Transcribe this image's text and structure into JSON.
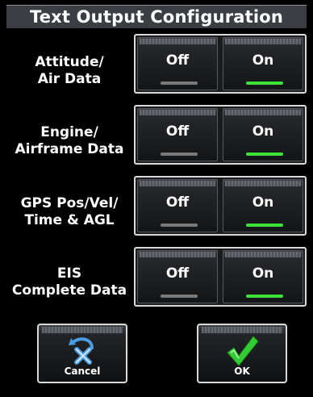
{
  "title": "Text Output Configuration",
  "rows": [
    {
      "label": "Attitude/\nAir Data",
      "off_label": "Off",
      "on_label": "On",
      "selected": "on"
    },
    {
      "label": "Engine/\nAirframe Data",
      "off_label": "Off",
      "on_label": "On",
      "selected": "on"
    },
    {
      "label": "GPS Pos/Vel/\nTime & AGL",
      "off_label": "Off",
      "on_label": "On",
      "selected": "on"
    },
    {
      "label": "EIS\nComplete Data",
      "off_label": "Off",
      "on_label": "On",
      "selected": "on"
    }
  ],
  "buttons": {
    "cancel_label": "Cancel",
    "cancel_icon": "cancel-arrow-x-icon",
    "ok_label": "OK",
    "ok_icon": "checkmark-icon"
  },
  "colors": {
    "indicator_on": "#3ee03a",
    "indicator_off": "#7a7a7a",
    "ok_check": "#33cc33",
    "cancel_icon": "#4a9de0"
  }
}
